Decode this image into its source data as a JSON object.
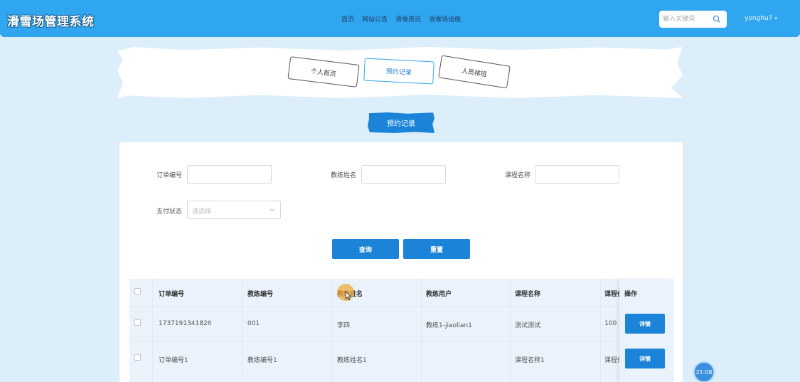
{
  "header": {
    "brand": "滑雪场管理系统",
    "nav": [
      "首页",
      "网站公告",
      "滑雪资讯",
      "滑雪场设施"
    ],
    "search_placeholder": "输入关键词",
    "user": "yonghu7"
  },
  "tabs": [
    {
      "label": "个人首页",
      "active": false
    },
    {
      "label": "预约记录",
      "active": true
    },
    {
      "label": "人员排班",
      "active": false
    }
  ],
  "section_title": "预约记录",
  "filters": {
    "order_no_label": "订单编号",
    "coach_name_label": "教练姓名",
    "course_name_label": "课程名称",
    "pay_status_label": "支付状态",
    "pay_status_placeholder": "请选择"
  },
  "buttons": {
    "query": "查询",
    "reset": "重置"
  },
  "table": {
    "headers": [
      "订单编号",
      "教练编号",
      "教练姓名",
      "教练用户",
      "课程名称",
      "课程价",
      "操作"
    ],
    "rows": [
      {
        "order_no": "1737191341826",
        "coach_no": "001",
        "coach_name": "李四",
        "coach_user": "教练1-jiaolian1",
        "course_name": "测试测试",
        "price": "100",
        "action": "详情"
      },
      {
        "order_no": "订单编号1",
        "coach_no": "教练编号1",
        "coach_name": "教练姓名1",
        "coach_user": "",
        "course_name": "课程名称1",
        "price": "课程价",
        "action": "详情"
      }
    ]
  },
  "clock": "21:08",
  "colors": {
    "primary": "#1b84d8",
    "topbar": "#2fa6ef",
    "background": "#dceefa"
  }
}
